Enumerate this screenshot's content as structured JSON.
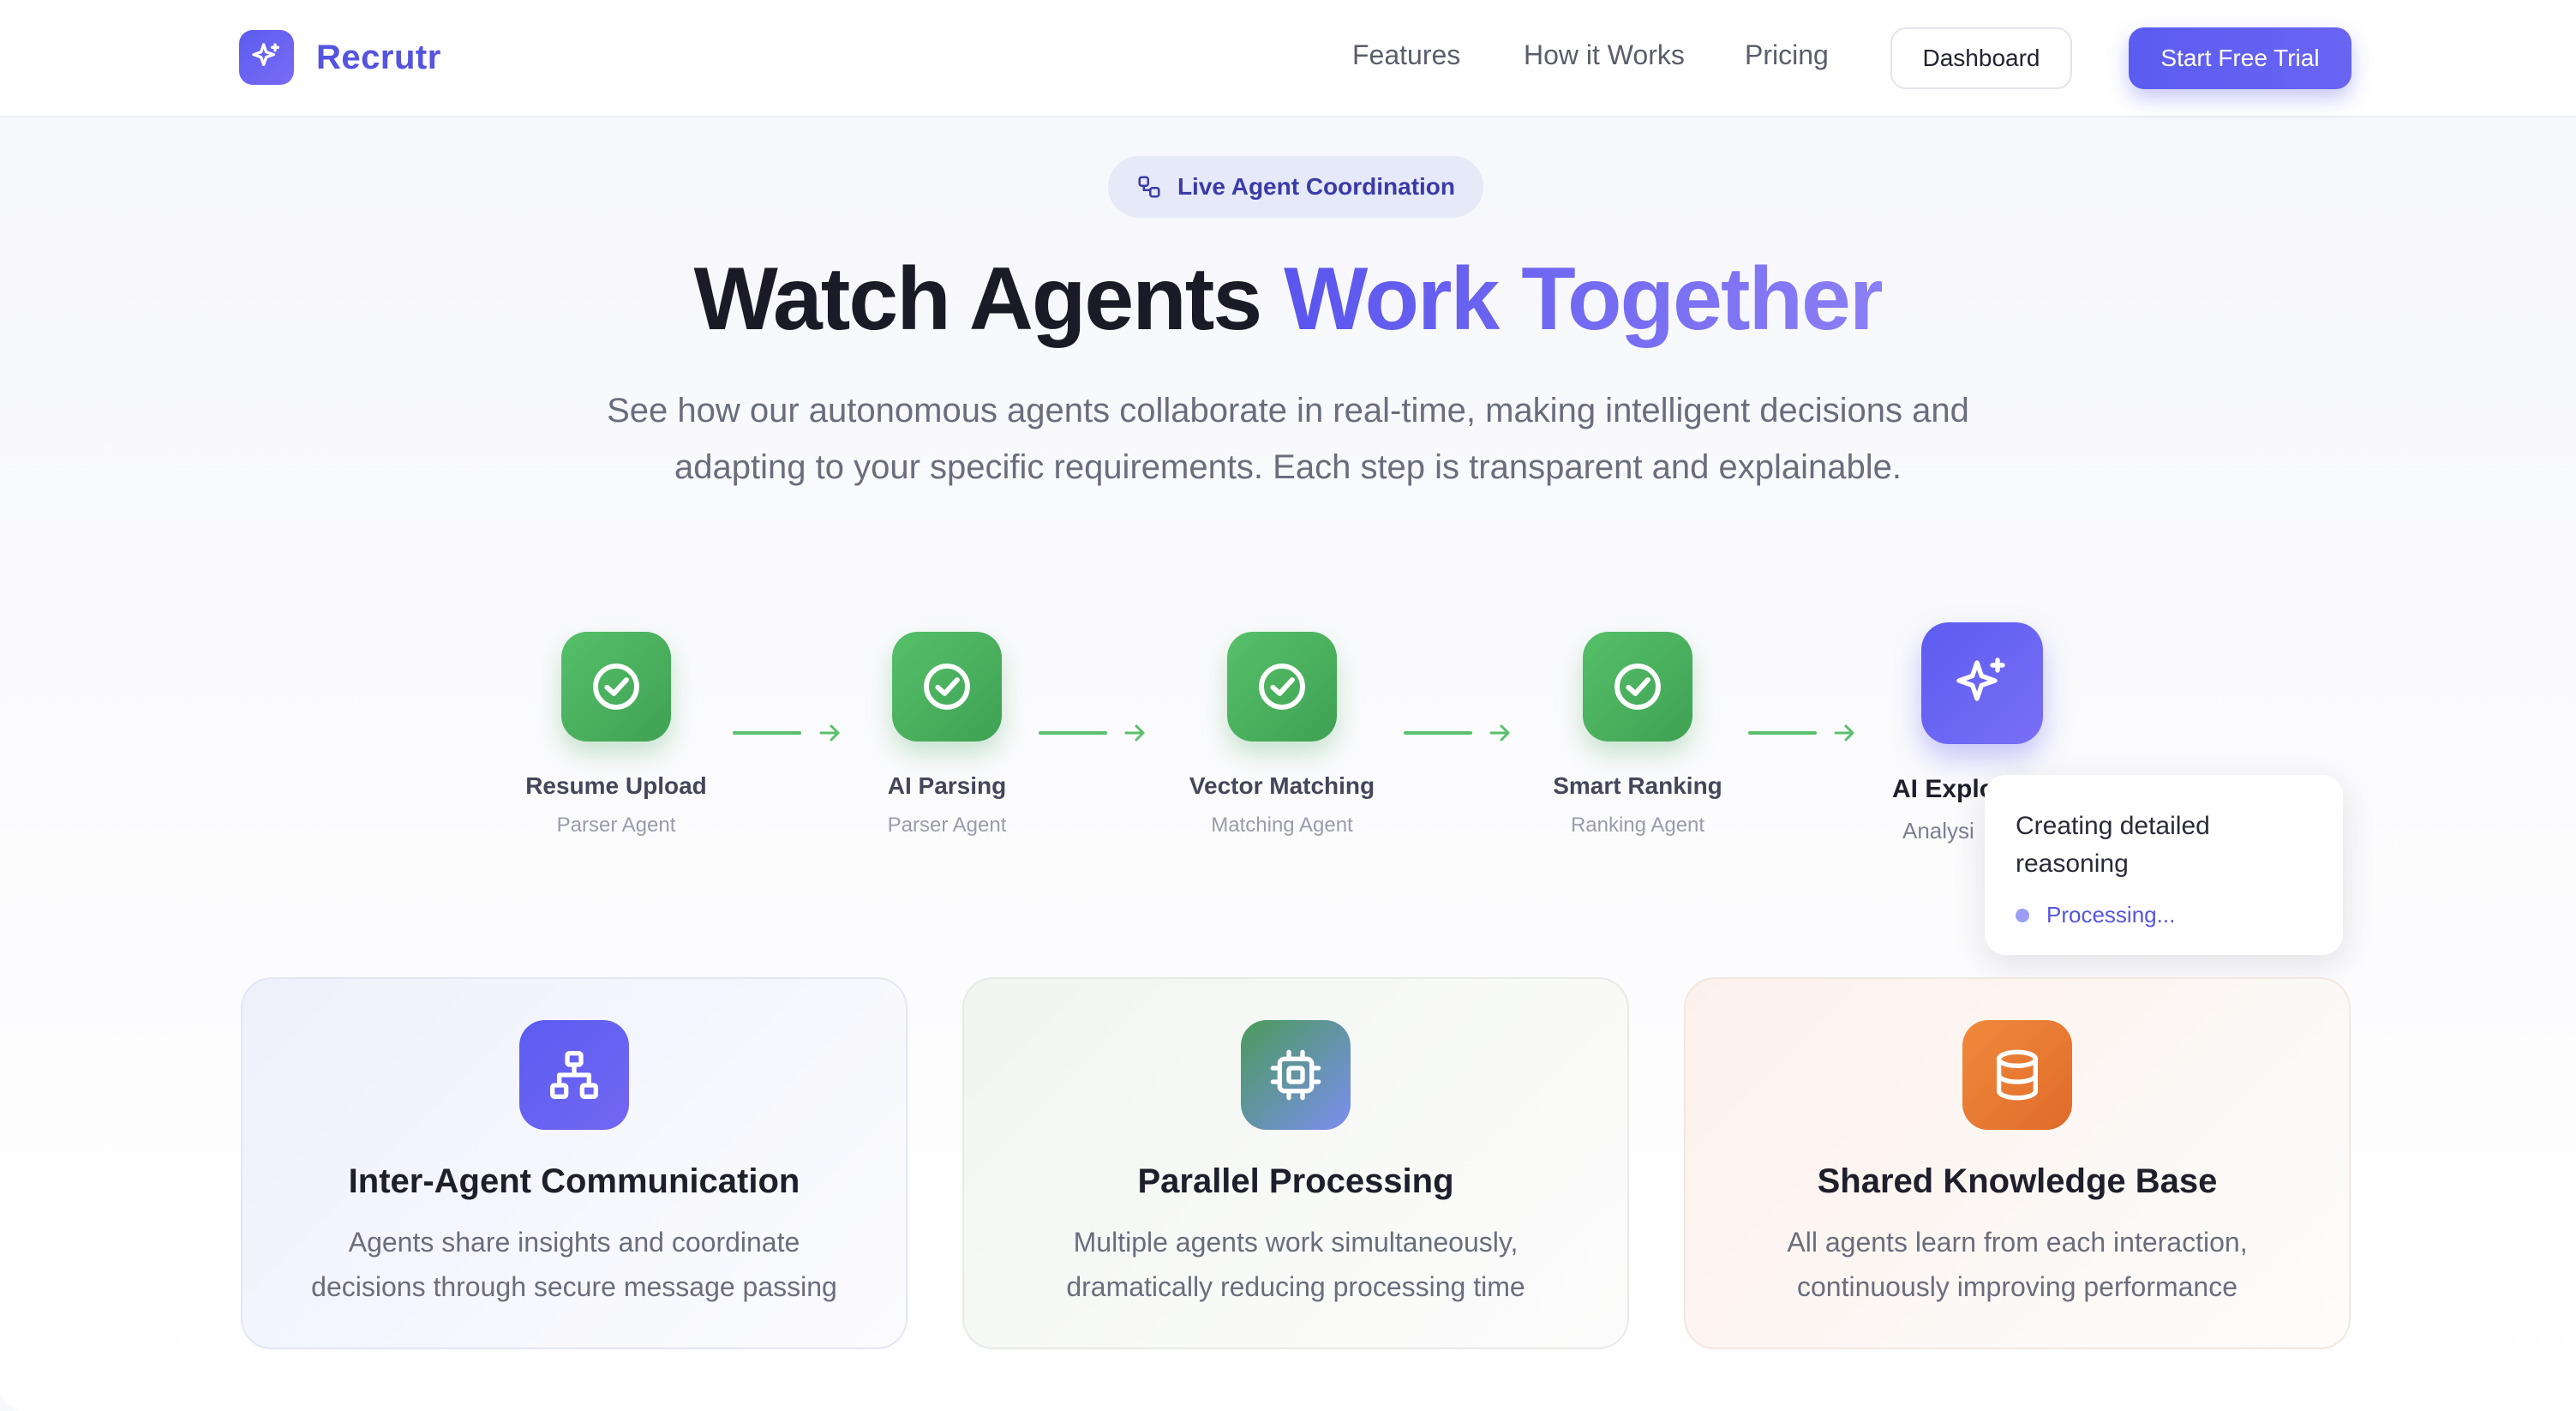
{
  "brand": {
    "name": "Recrutr",
    "icon": "sparkle-icon"
  },
  "nav": {
    "links": [
      "Features",
      "How it Works",
      "Pricing"
    ],
    "dashboard_label": "Dashboard",
    "trial_label": "Start Free Trial"
  },
  "hero": {
    "badge": {
      "label": "Live Agent Coordination",
      "icon": "link-nodes-icon"
    },
    "headline_plain": "Watch Agents ",
    "headline_accent": "Work Together",
    "subtitle_line1": "See how our autonomous agents collaborate in real-time, making intelligent decisions and",
    "subtitle_line2": "adapting to your specific requirements. Each step is transparent and explainable."
  },
  "pipeline": {
    "steps": [
      {
        "title": "Resume Upload",
        "agent": "Parser Agent",
        "status": "complete",
        "icon": "check-circle-icon"
      },
      {
        "title": "AI Parsing",
        "agent": "Parser Agent",
        "status": "complete",
        "icon": "check-circle-icon"
      },
      {
        "title": "Vector Matching",
        "agent": "Matching Agent",
        "status": "complete",
        "icon": "check-circle-icon"
      },
      {
        "title": "Smart Ranking",
        "agent": "Ranking Agent",
        "status": "complete",
        "icon": "check-circle-icon"
      },
      {
        "title": "AI Explo",
        "agent": "Analysi",
        "status": "active",
        "icon": "sparkle-icon"
      }
    ],
    "tooltip": {
      "title_line1": "Creating detailed",
      "title_line2": "reasoning",
      "status": "Processing..."
    }
  },
  "features": [
    {
      "title": "Inter-Agent Communication",
      "line1": "Agents share insights and coordinate",
      "line2": "decisions through secure message passing",
      "icon": "network-icon",
      "accent": "#5b5cf0"
    },
    {
      "title": "Parallel Processing",
      "line1": "Multiple agents work simultaneously,",
      "line2": "dramatically reducing processing time",
      "icon": "cpu-icon",
      "accent": "#4b9a5b"
    },
    {
      "title": "Shared Knowledge Base",
      "line1": "All agents learn from each interaction,",
      "line2": "continuously improving performance",
      "icon": "database-icon",
      "accent": "#f08a3c"
    }
  ],
  "colors": {
    "primary": "#5b5cf0",
    "success": "#4caf5f",
    "orange": "#f08a3c"
  }
}
